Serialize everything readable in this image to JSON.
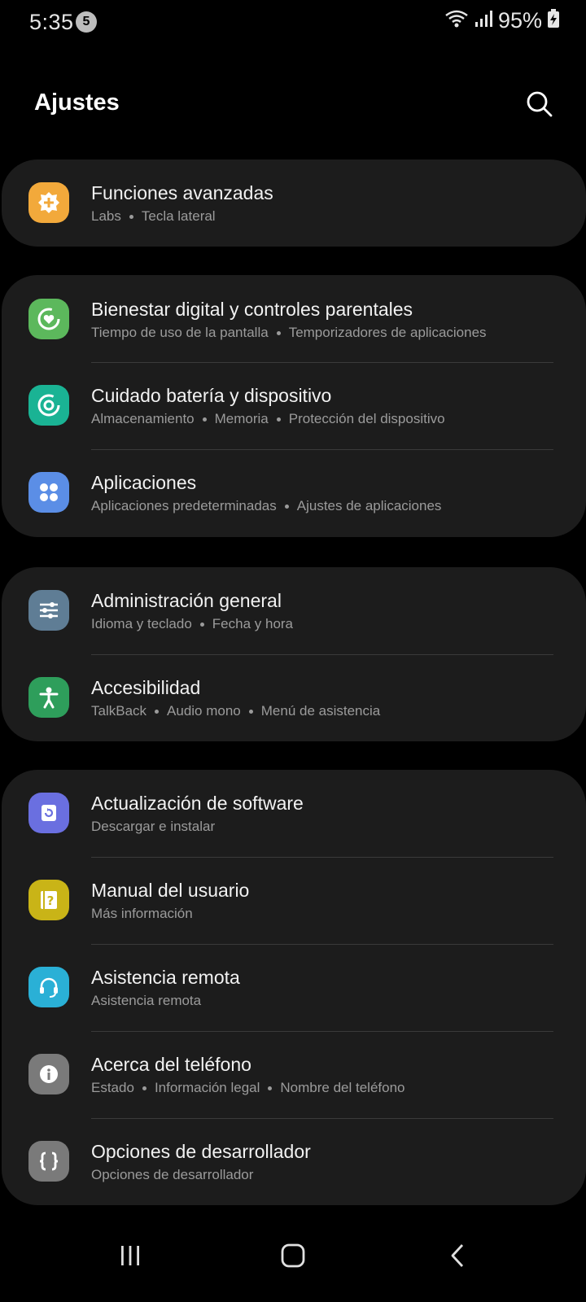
{
  "status": {
    "time": "5:35",
    "notification_count": "5",
    "battery": "95%"
  },
  "header": {
    "title": "Ajustes"
  },
  "groups": [
    {
      "items": [
        {
          "title": "Funciones avanzadas",
          "subs": [
            "Labs",
            "Tecla lateral"
          ],
          "icon": "advanced-features-icon",
          "color": "#f2a93b"
        }
      ]
    },
    {
      "items": [
        {
          "title": "Bienestar digital y controles parentales",
          "subs": [
            "Tiempo de uso de la pantalla",
            "Temporizadores de aplicaciones"
          ],
          "icon": "digital-wellbeing-icon",
          "color": "#5cb85c"
        },
        {
          "title": "Cuidado batería y dispositivo",
          "subs": [
            "Almacenamiento",
            "Memoria",
            "Protección del dispositivo"
          ],
          "icon": "device-care-icon",
          "color": "#1ab394"
        },
        {
          "title": "Aplicaciones",
          "subs": [
            "Aplicaciones predeterminadas",
            "Ajustes de aplicaciones"
          ],
          "icon": "apps-icon",
          "color": "#5b8ee6"
        }
      ]
    },
    {
      "items": [
        {
          "title": "Administración general",
          "subs": [
            "Idioma y teclado",
            "Fecha y hora"
          ],
          "icon": "general-management-icon",
          "color": "#5f7d95"
        },
        {
          "title": "Accesibilidad",
          "subs": [
            "TalkBack",
            "Audio mono",
            "Menú de asistencia"
          ],
          "icon": "accessibility-icon",
          "color": "#2e9e5b"
        }
      ]
    },
    {
      "items": [
        {
          "title": "Actualización de software",
          "subs": [
            "Descargar e instalar"
          ],
          "icon": "software-update-icon",
          "color": "#6a6fe0"
        },
        {
          "title": "Manual del usuario",
          "subs": [
            "Más información"
          ],
          "icon": "user-manual-icon",
          "color": "#c9b417"
        },
        {
          "title": "Asistencia remota",
          "subs": [
            "Asistencia remota"
          ],
          "icon": "remote-support-icon",
          "color": "#2ab0d6"
        },
        {
          "title": "Acerca del teléfono",
          "subs": [
            "Estado",
            "Información legal",
            "Nombre del teléfono"
          ],
          "icon": "about-phone-icon",
          "color": "#7a7a7a"
        },
        {
          "title": "Opciones de desarrollador",
          "subs": [
            "Opciones de desarrollador"
          ],
          "icon": "developer-options-icon",
          "color": "#7a7a7a"
        }
      ]
    }
  ]
}
